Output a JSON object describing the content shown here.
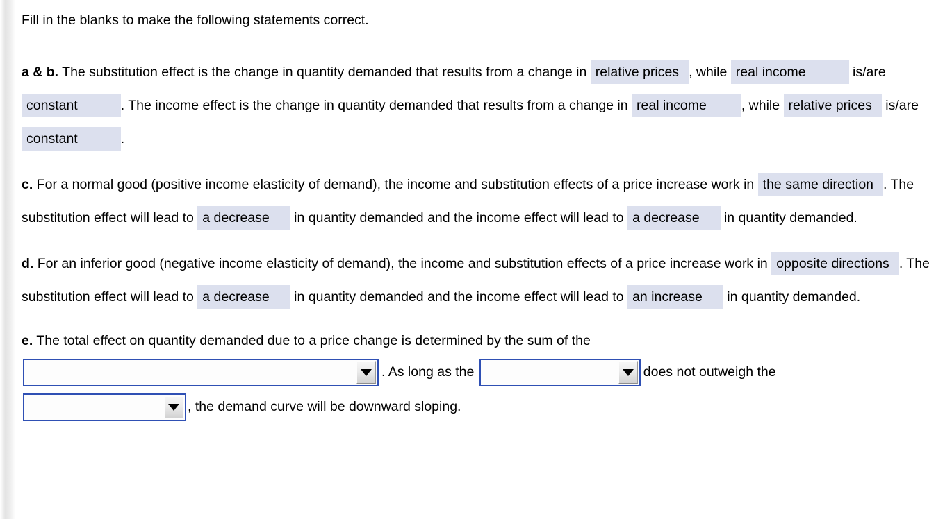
{
  "theme": {
    "blank_fill": "#dce0ee",
    "select_border": "#2f50b4",
    "text_color": "#000000",
    "page_background": "#ffffff"
  },
  "intro": {
    "text": "Fill in the blanks to make the following statements correct."
  },
  "items": [
    {
      "label": "a & b.",
      "segments": [
        {
          "type": "text",
          "value": " The substitution effect is the change in quantity demanded that results from a change in "
        },
        {
          "type": "blank",
          "value": "relative prices",
          "pad": "pad-sm"
        },
        {
          "type": "text",
          "value": ", while "
        },
        {
          "type": "blank",
          "value": "real income",
          "pad": "pad-xl"
        },
        {
          "type": "text",
          "value": " is/are "
        },
        {
          "type": "blank",
          "value": "constant",
          "pad": "pad-xl"
        },
        {
          "type": "text",
          "value": ". The income effect is the change in quantity demanded that results from a change in "
        },
        {
          "type": "blank",
          "value": "real income",
          "pad": "pad-lg"
        },
        {
          "type": "text",
          "value": ", while "
        },
        {
          "type": "blank",
          "value": "relative prices",
          "pad": "pad-sm"
        },
        {
          "type": "text",
          "value": " is/are "
        },
        {
          "type": "blank",
          "value": "constant",
          "pad": "pad-xl"
        },
        {
          "type": "text",
          "value": "."
        }
      ]
    },
    {
      "label": "c.",
      "segments": [
        {
          "type": "text",
          "value": " For a normal good (positive income elasticity of demand), the income and substitution effects of a price increase work in "
        },
        {
          "type": "blank",
          "value": "the same direction",
          "pad": "pad-sm"
        },
        {
          "type": "text",
          "value": ". The substitution effect will lead to "
        },
        {
          "type": "blank",
          "value": "a decrease",
          "pad": "pad-md"
        },
        {
          "type": "text",
          "value": " in quantity demanded and the income effect will lead to "
        },
        {
          "type": "blank",
          "value": "a decrease",
          "pad": "pad-md"
        },
        {
          "type": "text",
          "value": " in quantity demanded."
        }
      ]
    },
    {
      "label": "d.",
      "segments": [
        {
          "type": "text",
          "value": " For an inferior good (negative income elasticity of demand), the income and substitution effects of a price increase work in "
        },
        {
          "type": "blank",
          "value": "opposite directions",
          "pad": "pad-sm"
        },
        {
          "type": "text",
          "value": ". The substitution effect will lead to "
        },
        {
          "type": "blank",
          "value": "a decrease",
          "pad": "pad-md"
        },
        {
          "type": "text",
          "value": " in quantity demanded and the income effect will lead to "
        },
        {
          "type": "blank",
          "value": "an increase",
          "pad": "pad-md"
        },
        {
          "type": "text",
          "value": " in quantity demanded."
        }
      ]
    }
  ],
  "item_e": {
    "label": "e.",
    "lead_text": " The total effect on quantity demanded due to a price change is determined by the sum of the",
    "select_1": {
      "value": "",
      "placeholder": "",
      "arrow_icon": "chevron-down-icon"
    },
    "mid_text_1": ". As long as the",
    "select_2": {
      "value": "",
      "placeholder": "",
      "arrow_icon": "chevron-down-icon"
    },
    "mid_text_2": "does not outweigh the",
    "select_3": {
      "value": "",
      "placeholder": "",
      "arrow_icon": "chevron-down-icon"
    },
    "tail_text": ", the demand curve will be downward sloping."
  }
}
